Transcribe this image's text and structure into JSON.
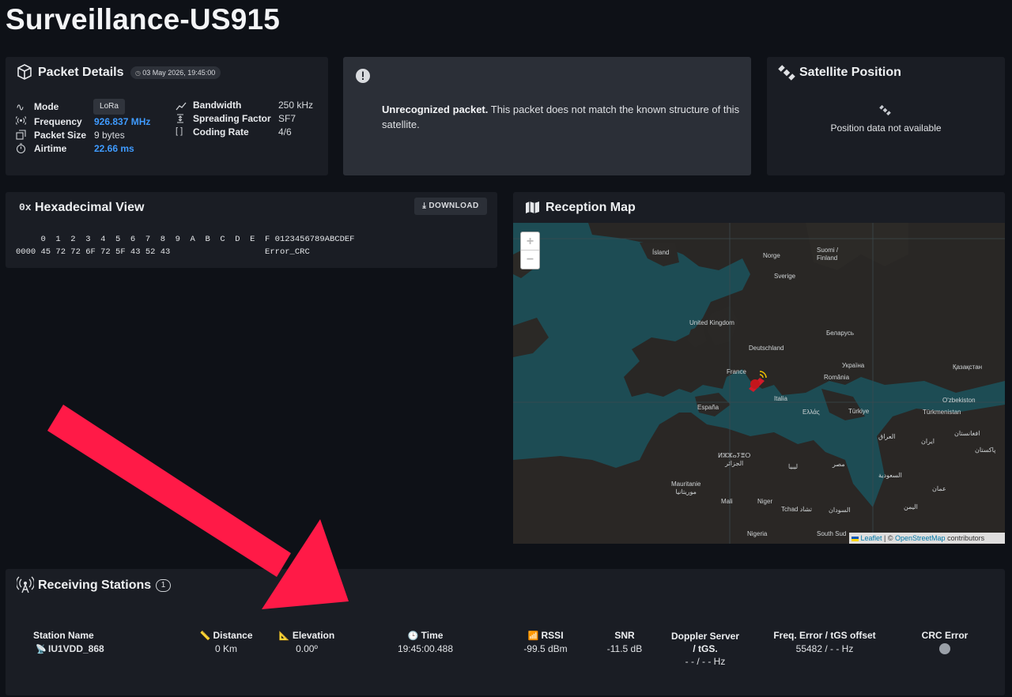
{
  "page_title": "Surveillance-US915",
  "packet_details": {
    "title": "Packet Details",
    "date_badge": "03 May 2026, 19:45:00",
    "mode_label": "Mode",
    "mode_value": "LoRa",
    "frequency_label": "Frequency",
    "frequency_value": "926.837 MHz",
    "packet_size_label": "Packet Size",
    "packet_size_value": "9 bytes",
    "airtime_label": "Airtime",
    "airtime_value": "22.66 ms",
    "bandwidth_label": "Bandwidth",
    "bandwidth_value": "250 kHz",
    "spreading_factor_label": "Spreading Factor",
    "spreading_factor_value": "SF7",
    "coding_rate_label": "Coding Rate",
    "coding_rate_value": "4/6"
  },
  "alert": {
    "bold": "Unrecognized packet.",
    "text": " This packet does not match the known structure of this",
    "text_line2": "satellite."
  },
  "satellite_position": {
    "title": "Satellite Position",
    "message": "Position data not available"
  },
  "hex_view": {
    "title": "Hexadecimal View",
    "icon_text": "0x",
    "download_label": "DOWNLOAD",
    "header_row": "     0  1  2  3  4  5  6  7  8  9  A  B  C  D  E  F 0123456789ABCDEF",
    "data_row": "0000 45 72 72 6F 72 5F 43 52 43                   Error_CRC"
  },
  "reception_map": {
    "title": "Reception Map",
    "zoom_in": "+",
    "zoom_out": "−",
    "attribution_leaflet": "Leaflet",
    "attribution_sep": " | © ",
    "attribution_osm": "OpenStreetMap",
    "attribution_tail": " contributors",
    "labels": {
      "island": "Ísland",
      "norge": "Norge",
      "suomi": "Suomi / Finland",
      "sverige": "Sverige",
      "uk": "United Kingdom",
      "belarus": "Беларусь",
      "deutschland": "Deutschland",
      "ukraina": "Україна",
      "kazakhstan": "Қазақстан",
      "france": "France",
      "romania": "România",
      "uzbekistan": "O'zbekiston",
      "espana": "España",
      "italia": "Italia",
      "ellas": "Ελλάς",
      "turkiye": "Türkiye",
      "turkmenistan": "Türkmenistan",
      "iraq": "العراق",
      "afghanistan": "افغانستان",
      "iran": "ایران",
      "pakistan": "پاکستان",
      "algeria": "ⵍⵣⵣⴰⵢⴻⵔ\nالجزائر",
      "libya": "ليبيا",
      "egypt": "مصر",
      "saudi": "السعودية",
      "mauritanie": "Mauritanie\nموريتانيا",
      "mali": "Mali",
      "niger": "Niger",
      "tchad": "Tchad تشاد",
      "sudan": "السودان",
      "yemen": "اليمن",
      "oman": "عمان",
      "nigeria": "Nigeria",
      "south_sudan": "South Sud"
    }
  },
  "receiving_stations": {
    "title": "Receiving Stations",
    "count": "1",
    "headers": {
      "station_name": "Station Name",
      "distance": "Distance",
      "elevation": "Elevation",
      "time": "Time",
      "rssi": "RSSI",
      "snr": "SNR",
      "doppler_line1": "Doppler Server",
      "doppler_line2": "/ tGS.",
      "freq_error": "Freq. Error / tGS offset",
      "crc_error": "CRC Error"
    },
    "rows": [
      {
        "station_name": "IU1VDD_868",
        "distance": "0 Km",
        "elevation": "0.00º",
        "time": "19:45:00.488",
        "rssi": "-99.5 dBm",
        "snr": "-11.5 dB",
        "doppler": "- - / - - Hz",
        "freq_error": "55482 / - - Hz"
      }
    ]
  },
  "colors": {
    "background": "#0e1117",
    "card": "#1a1d24",
    "accent_blue": "#3f9bff",
    "arrow_red": "#ff1744"
  }
}
